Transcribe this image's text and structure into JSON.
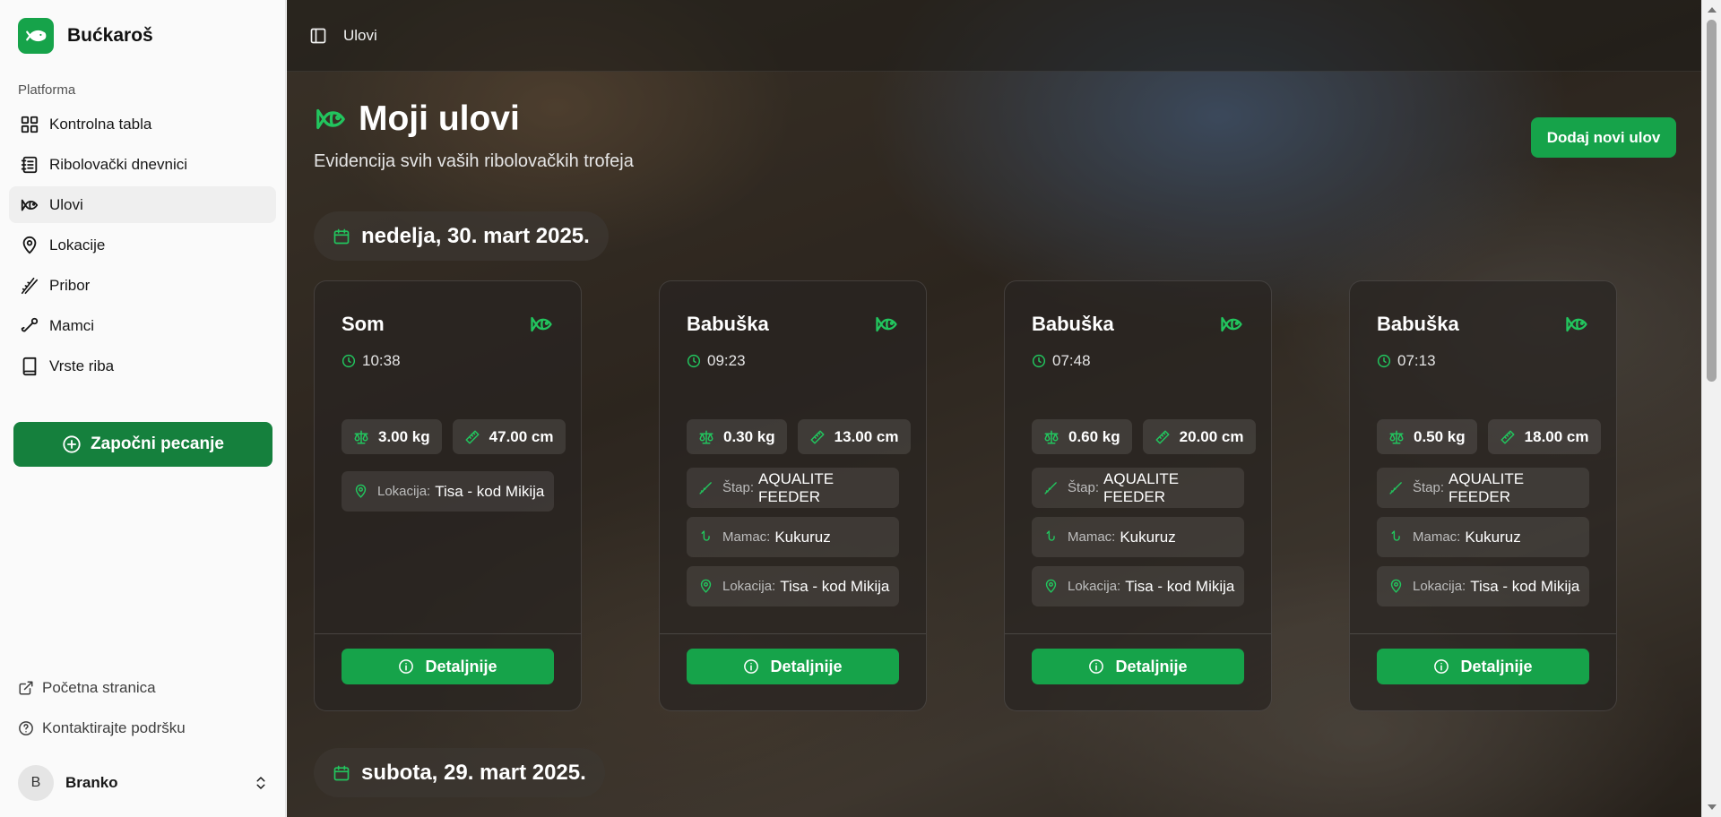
{
  "app": {
    "name": "Bućkaroš"
  },
  "sidebar": {
    "group_label": "Platforma",
    "items": [
      {
        "label": "Kontrolna tabla",
        "icon": "grid-icon"
      },
      {
        "label": "Ribolovački dnevnici",
        "icon": "notebook-icon"
      },
      {
        "label": "Ulovi",
        "icon": "fish-icon",
        "active": true
      },
      {
        "label": "Lokacije",
        "icon": "map-pin-icon"
      },
      {
        "label": "Pribor",
        "icon": "fishing-rods-icon"
      },
      {
        "label": "Mamci",
        "icon": "hook-icon"
      },
      {
        "label": "Vrste riba",
        "icon": "book-icon"
      }
    ],
    "start_button": "Započni pecanje",
    "footer_links": [
      {
        "label": "Početna stranica",
        "icon": "external-link-icon"
      },
      {
        "label": "Kontaktirajte podršku",
        "icon": "help-circle-icon"
      }
    ],
    "user": {
      "initial": "B",
      "name": "Branko"
    }
  },
  "topbar": {
    "title": "Ulovi"
  },
  "page": {
    "title": "Moji ulovi",
    "subtitle": "Evidencija svih vaših ribolovačkih trofeja",
    "add_button": "Dodaj novi ulov"
  },
  "groups": [
    {
      "date": "nedelja, 30. mart 2025.",
      "catches": [
        {
          "species": "Som",
          "time": "10:38",
          "weight": "3.00 kg",
          "length": "47.00 cm",
          "location_label": "Lokacija:",
          "location": "Tisa - kod Mikija",
          "details_label": "Detaljnije"
        },
        {
          "species": "Babuška",
          "time": "09:23",
          "weight": "0.30 kg",
          "length": "13.00 cm",
          "rod_label": "Štap:",
          "rod": "AQUALITE FEEDER",
          "bait_label": "Mamac:",
          "bait": "Kukuruz",
          "location_label": "Lokacija:",
          "location": "Tisa - kod Mikija",
          "details_label": "Detaljnije"
        },
        {
          "species": "Babuška",
          "time": "07:48",
          "weight": "0.60 kg",
          "length": "20.00 cm",
          "rod_label": "Štap:",
          "rod": "AQUALITE FEEDER",
          "bait_label": "Mamac:",
          "bait": "Kukuruz",
          "location_label": "Lokacija:",
          "location": "Tisa - kod Mikija",
          "details_label": "Detaljnije"
        },
        {
          "species": "Babuška",
          "time": "07:13",
          "weight": "0.50 kg",
          "length": "18.00 cm",
          "rod_label": "Štap:",
          "rod": "AQUALITE FEEDER",
          "bait_label": "Mamac:",
          "bait": "Kukuruz",
          "location_label": "Lokacija:",
          "location": "Tisa - kod Mikija",
          "details_label": "Detaljnije"
        }
      ]
    },
    {
      "date": "subota, 29. mart 2025."
    }
  ],
  "colors": {
    "accent": "#16a34a",
    "accent_dark": "#15803d",
    "icon_green": "#22c55e"
  }
}
